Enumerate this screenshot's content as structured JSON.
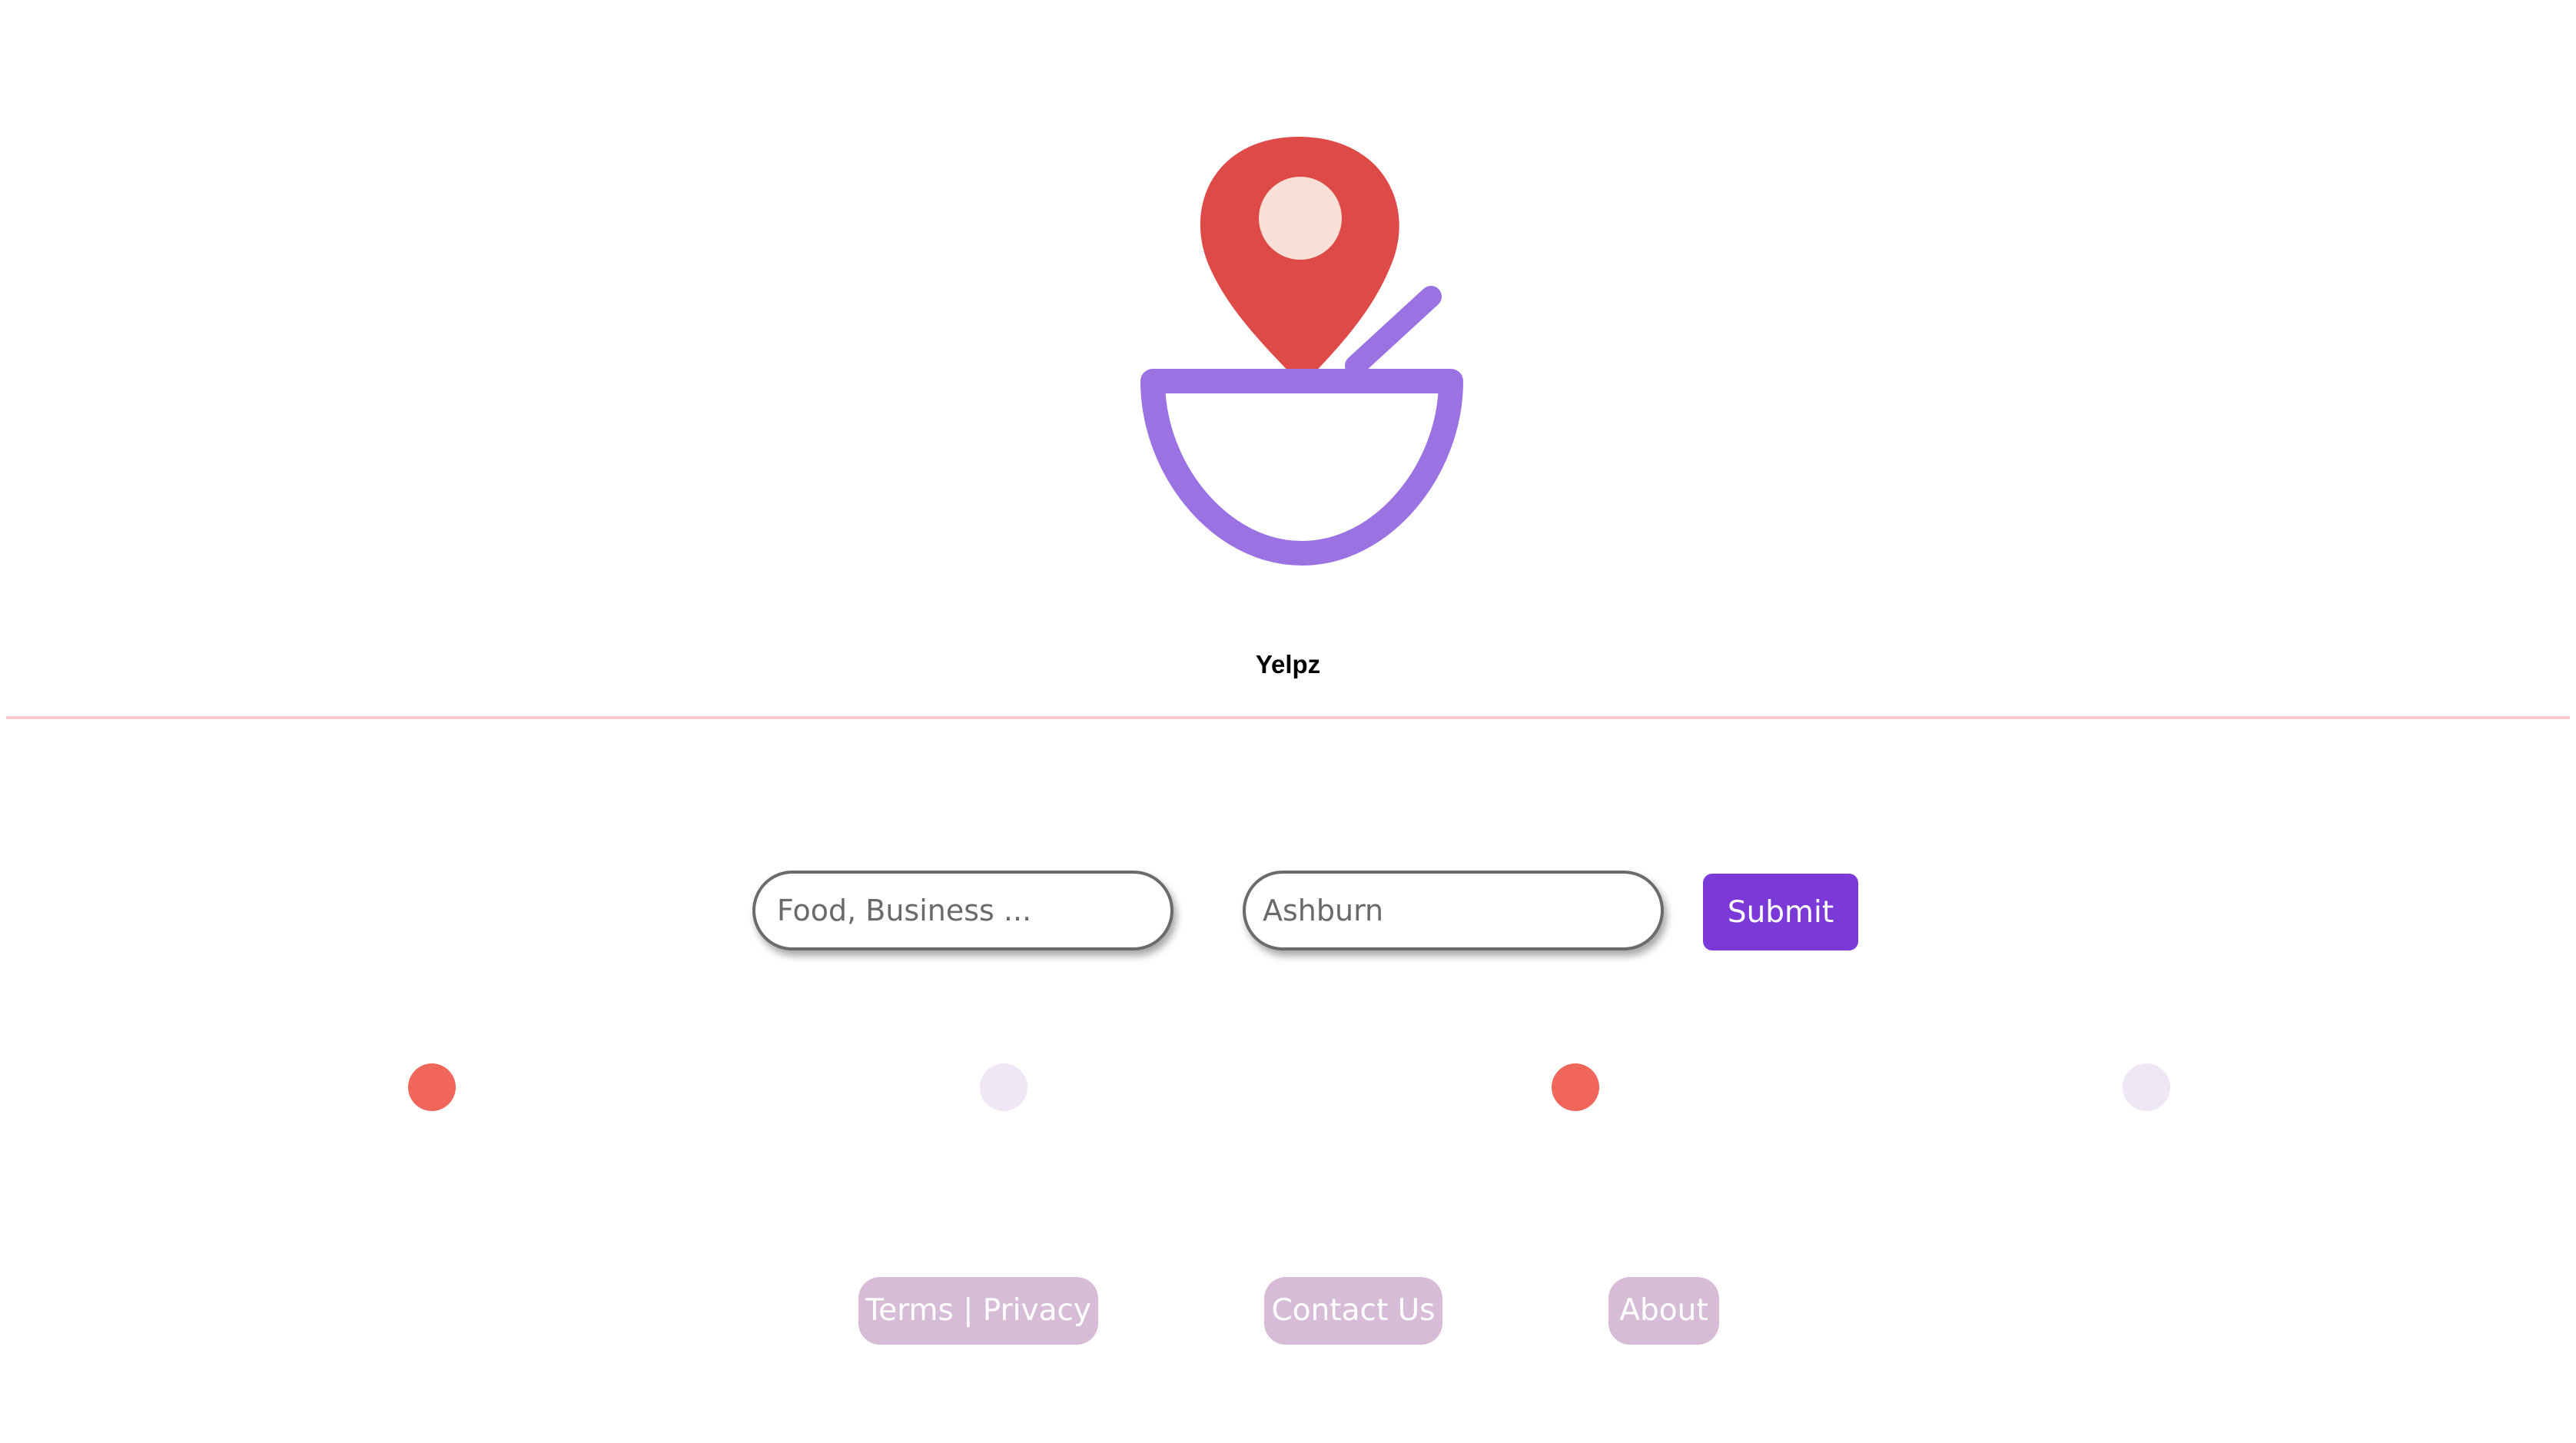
{
  "brand": {
    "name": "Yelpz",
    "logo_icon": "map-pin-bowl-icon"
  },
  "search": {
    "query_placeholder": "Food, Business ...",
    "location_placeholder": "Ashburn",
    "submit_label": "Submit"
  },
  "indicators": [
    {
      "state": "active",
      "color": "#f0665a"
    },
    {
      "state": "inactive",
      "color": "#efe7f5"
    },
    {
      "state": "active",
      "color": "#f0665a"
    },
    {
      "state": "inactive",
      "color": "#efe7f5"
    }
  ],
  "footer": {
    "terms_privacy": "Terms | Privacy",
    "contact": "Contact Us",
    "about": "About"
  },
  "colors": {
    "accent": "#7b3ad8",
    "pin": "#dd4a48",
    "pin_center": "#f9e0d6",
    "bowl": "#9b72e1",
    "divider": "#f6c9cf",
    "footer_pill": "#d6bcd6"
  }
}
